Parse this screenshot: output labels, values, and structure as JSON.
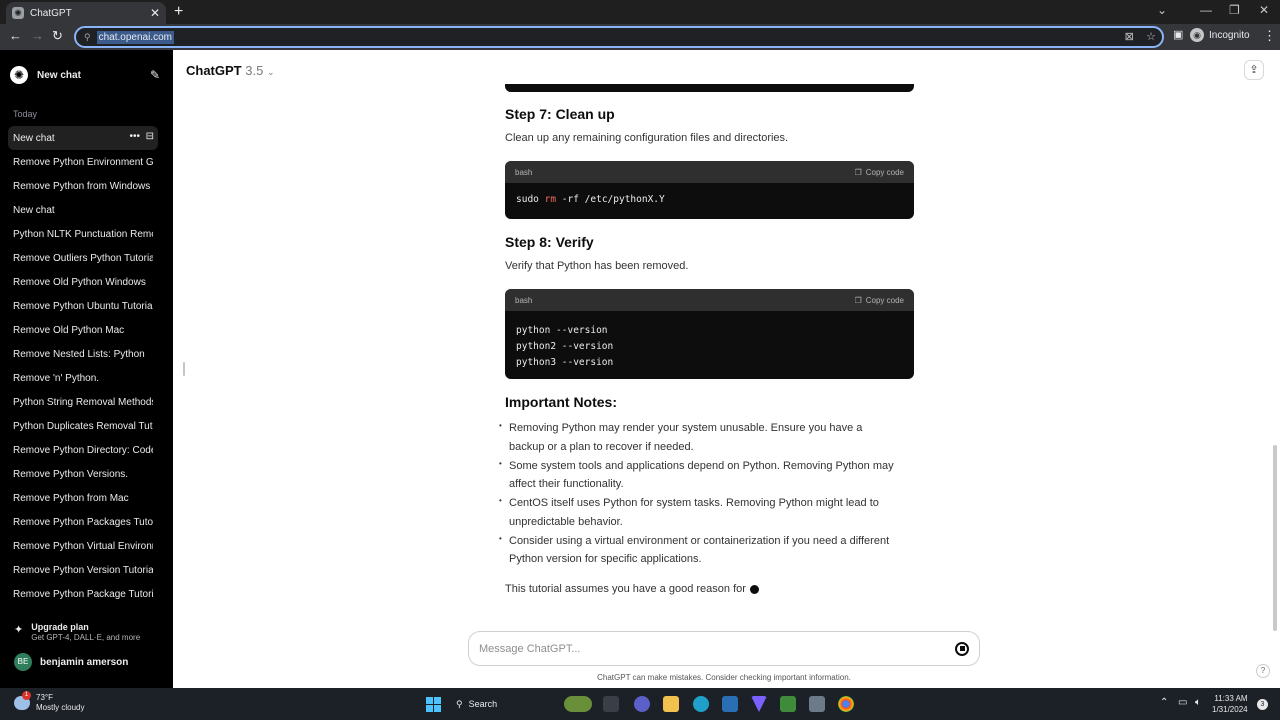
{
  "browser": {
    "tab_title": "ChatGPT",
    "url": "chat.openai.com",
    "profile_label": "Incognito"
  },
  "sidebar": {
    "new_chat_label": "New chat",
    "section_today": "Today",
    "items": [
      {
        "label": "New chat"
      },
      {
        "label": "Remove Python Environment Gui"
      },
      {
        "label": "Remove Python from Windows"
      },
      {
        "label": "New chat"
      },
      {
        "label": "Python NLTK Punctuation Remov"
      },
      {
        "label": "Remove Outliers Python Tutorial"
      },
      {
        "label": "Remove Old Python Windows"
      },
      {
        "label": "Remove Python Ubuntu Tutorial"
      },
      {
        "label": "Remove Old Python Mac"
      },
      {
        "label": "Remove Nested Lists: Python"
      },
      {
        "label": "Remove 'n' Python."
      },
      {
        "label": "Python String Removal Methods"
      },
      {
        "label": "Python Duplicates Removal Tutor"
      },
      {
        "label": "Remove Python Directory: Code"
      },
      {
        "label": "Remove Python Versions."
      },
      {
        "label": "Remove Python from Mac"
      },
      {
        "label": "Remove Python Packages Tutoria"
      },
      {
        "label": "Remove Python Virtual Environm"
      },
      {
        "label": "Remove Python Version Tutorial"
      },
      {
        "label": "Remove Python Package Tutorial"
      }
    ],
    "upgrade_title": "Upgrade plan",
    "upgrade_sub": "Get GPT-4, DALL·E, and more",
    "user_initials": "BE",
    "user_name": "benjamin amerson"
  },
  "header": {
    "model_name": "ChatGPT",
    "model_version": "3.5"
  },
  "content": {
    "step7_title": "Step 7: Clean up",
    "step7_text": "Clean up any remaining configuration files and directories.",
    "code1": {
      "lang": "bash",
      "copy_label": "Copy code",
      "cmd": "sudo",
      "kw": "rm",
      "rest": " -rf /etc/pythonX.Y"
    },
    "step8_title": "Step 8: Verify",
    "step8_text": "Verify that Python has been removed.",
    "code2": {
      "lang": "bash",
      "copy_label": "Copy code",
      "lines": [
        "python --version",
        "python2 --version",
        "python3 --version"
      ]
    },
    "notes_title": "Important Notes:",
    "notes": [
      "Removing Python may render your system unusable. Ensure you have a backup or a plan to recover if needed.",
      "Some system tools and applications depend on Python. Removing Python may affect their functionality.",
      "CentOS itself uses Python for system tasks. Removing Python might lead to unpredictable behavior.",
      "Consider using a virtual environment or containerization if you need a different Python version for specific applications."
    ],
    "tutorial_text": "This tutorial assumes you have a good reason for"
  },
  "composer": {
    "placeholder": "Message ChatGPT...",
    "disclaimer": "ChatGPT can make mistakes. Consider checking important information."
  },
  "taskbar": {
    "weather_temp": "73°F",
    "weather_desc": "Mostly cloudy",
    "weather_badge": "1",
    "search_label": "Search",
    "time": "11:33 AM",
    "date": "1/31/2024",
    "notification_count": "3"
  }
}
